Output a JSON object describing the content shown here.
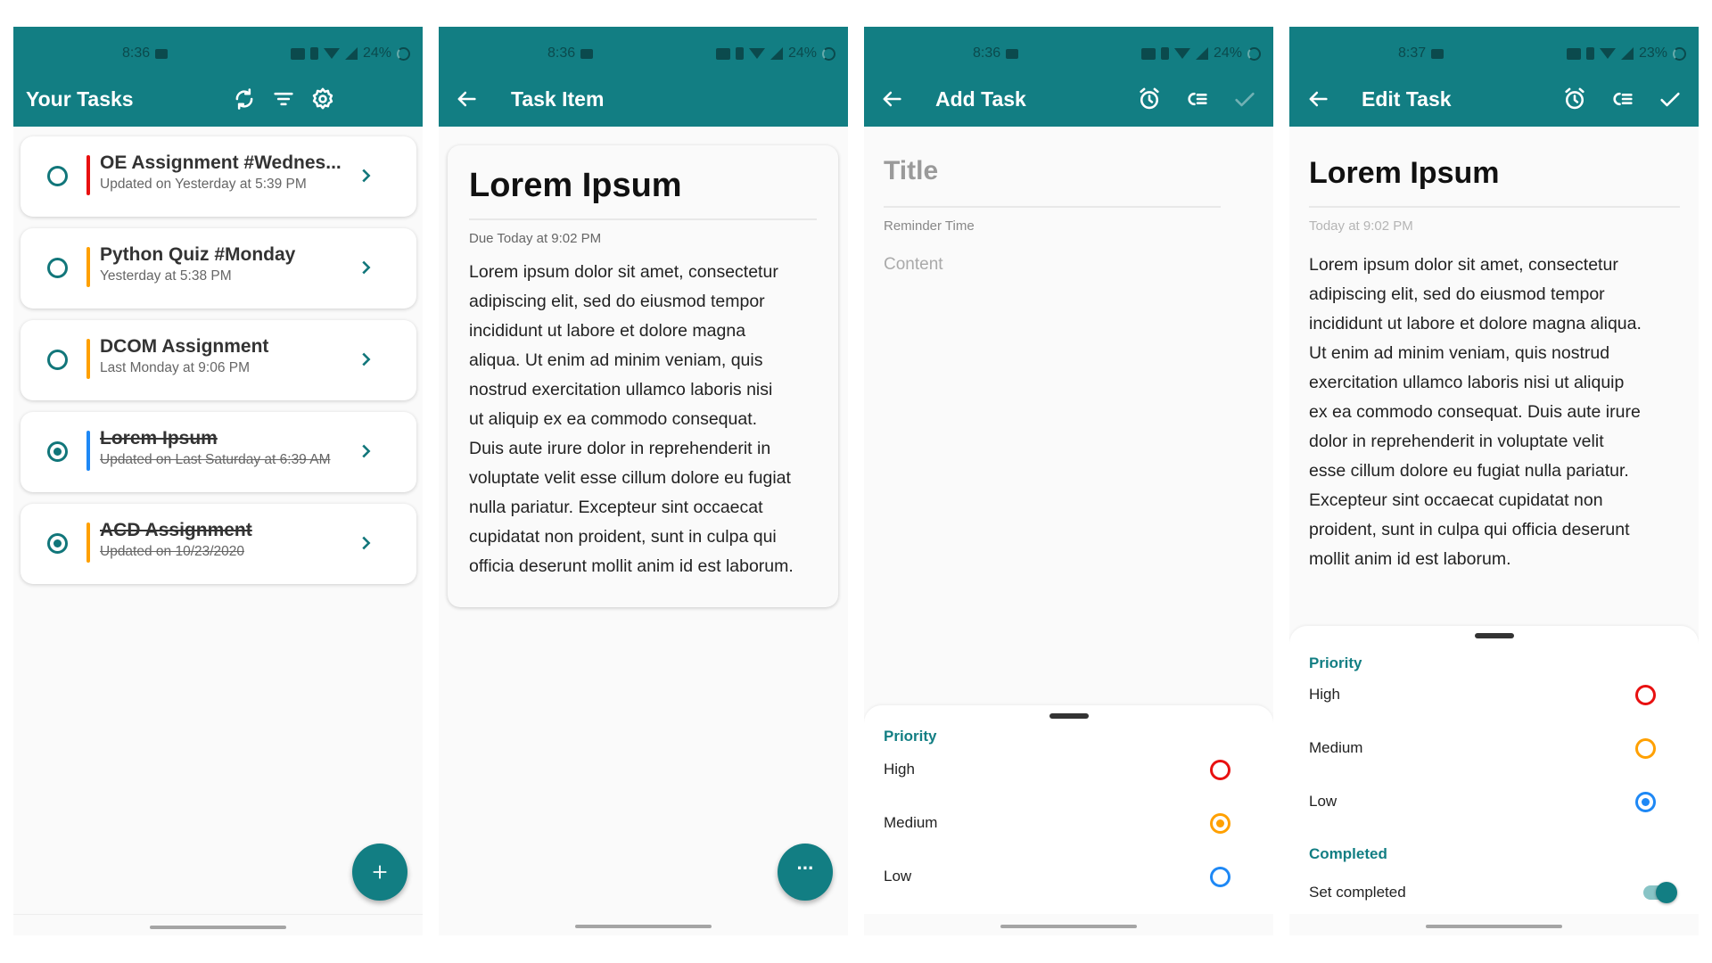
{
  "colors": {
    "primary": "#127e83",
    "high": "#e81010",
    "medium": "#ffa000",
    "low": "#1e88f5"
  },
  "panels": [
    {
      "status": {
        "time": "8:36",
        "battery": "24%"
      },
      "toolbar": {
        "title": "Your Tasks",
        "icons": [
          "sync-icon",
          "filter-icon",
          "gear-icon"
        ]
      },
      "tasks": [
        {
          "title": "OE Assignment #Wednes...",
          "subtitle": "Updated on Yesterday at 5:39 PM",
          "priority": "high",
          "completed": false
        },
        {
          "title": "Python Quiz #Monday",
          "subtitle": "Yesterday at 5:38 PM",
          "priority": "medium",
          "completed": false
        },
        {
          "title": "DCOM Assignment",
          "subtitle": "Last Monday at 9:06 PM",
          "priority": "medium",
          "completed": false
        },
        {
          "title": "Lorem Ipsum",
          "subtitle": "Updated on Last Saturday at 6:39 AM",
          "priority": "low",
          "completed": true
        },
        {
          "title": "ACD Assignment",
          "subtitle": "Updated on 10/23/2020",
          "priority": "medium",
          "completed": true
        }
      ],
      "fab_icon": "plus-icon"
    },
    {
      "status": {
        "time": "8:36",
        "battery": "24%"
      },
      "toolbar": {
        "title": "Task Item"
      },
      "task": {
        "title": "Lorem Ipsum",
        "due": "Due Today at 9:02 PM",
        "body_lines": [
          "Lorem ipsum dolor sit amet, consectetur",
          "adipiscing elit, sed do eiusmod tempor",
          "incididunt ut labore et dolore magna",
          "aliqua. Ut enim ad minim veniam, quis",
          "nostrud exercitation ullamco laboris nisi",
          "ut aliquip ex ea commodo consequat.",
          "Duis aute irure dolor in reprehenderit in",
          "voluptate velit esse cillum dolore eu fugiat",
          "nulla pariatur. Excepteur sint occaecat",
          "cupidatat non proident, sunt in culpa qui",
          "officia deserunt mollit anim id est laborum."
        ]
      },
      "fab_icon": "more-icon"
    },
    {
      "status": {
        "time": "8:36",
        "battery": "24%"
      },
      "toolbar": {
        "title": "Add Task"
      },
      "form": {
        "title_placeholder": "Title",
        "reminder_placeholder": "Reminder Time",
        "content_placeholder": "Content"
      },
      "sheet": {
        "priority_label": "Priority",
        "options": [
          "High",
          "Medium",
          "Low"
        ],
        "selected": "Medium"
      }
    },
    {
      "status": {
        "time": "8:37",
        "battery": "23%"
      },
      "toolbar": {
        "title": "Edit Task"
      },
      "form": {
        "title": "Lorem Ipsum",
        "reminder": "Today at 9:02 PM",
        "body_lines": [
          "Lorem ipsum dolor sit amet, consectetur",
          "adipiscing elit, sed do eiusmod tempor",
          "incididunt ut labore et dolore magna aliqua.",
          "Ut enim ad minim veniam, quis nostrud",
          "exercitation ullamco laboris nisi ut aliquip",
          "ex ea commodo consequat. Duis aute irure",
          "dolor in reprehenderit in voluptate velit",
          "esse cillum dolore eu fugiat nulla pariatur.",
          "Excepteur sint occaecat cupidatat non",
          "proident, sunt in culpa qui officia deserunt",
          "mollit anim id est laborum."
        ]
      },
      "sheet": {
        "priority_label": "Priority",
        "options": [
          "High",
          "Medium",
          "Low"
        ],
        "selected": "Low",
        "completed_label": "Completed",
        "set_completed_label": "Set completed",
        "set_completed": true
      }
    }
  ]
}
